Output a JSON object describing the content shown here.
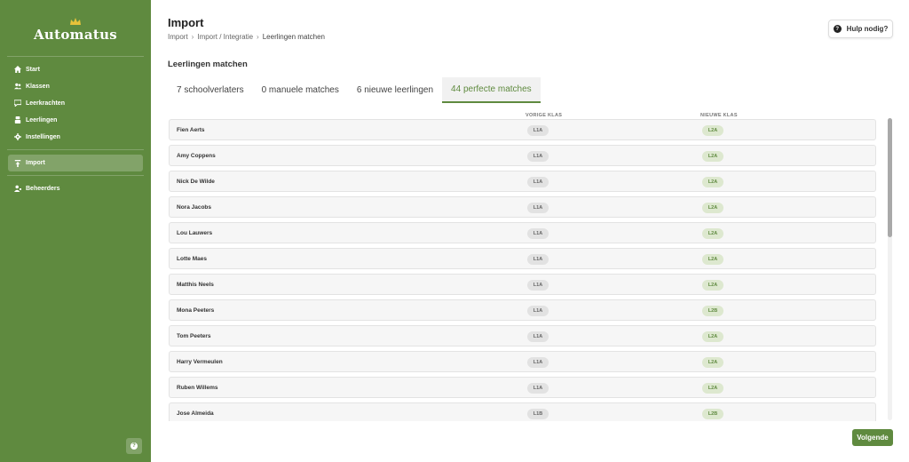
{
  "app": {
    "brand": "Automatus"
  },
  "sidebar": {
    "items": [
      {
        "label": "Start",
        "icon": "home-icon"
      },
      {
        "label": "Klassen",
        "icon": "users-icon"
      },
      {
        "label": "Leerkrachten",
        "icon": "chat-icon"
      },
      {
        "label": "Leerlingen",
        "icon": "student-icon"
      },
      {
        "label": "Instellingen",
        "icon": "gear-icon"
      },
      {
        "label": "Import",
        "icon": "import-icon",
        "active": true
      },
      {
        "label": "Beheerders",
        "icon": "admin-icon"
      }
    ],
    "help_icon": "?"
  },
  "header": {
    "title": "Import",
    "breadcrumb": [
      "Import",
      "Import / Integratie",
      "Leerlingen matchen"
    ],
    "breadcrumb_sep": "›",
    "help_label": "Hulp nodig?",
    "help_icon": "?"
  },
  "section_title": "Leerlingen matchen",
  "tabs": [
    {
      "label": "7 schoolverlaters"
    },
    {
      "label": "0 manuele matches"
    },
    {
      "label": "6 nieuwe leerlingen"
    },
    {
      "label": "44 perfecte matches",
      "active": true
    }
  ],
  "table": {
    "headers": {
      "prev": "VORIGE KLAS",
      "next": "NIEUWE KLAS"
    },
    "rows": [
      {
        "name": "Fien Aerts",
        "prev": "L1A",
        "next": "L2A"
      },
      {
        "name": "Amy Coppens",
        "prev": "L1A",
        "next": "L2A"
      },
      {
        "name": "Nick De Wilde",
        "prev": "L1A",
        "next": "L2A"
      },
      {
        "name": "Nora Jacobs",
        "prev": "L1A",
        "next": "L2A"
      },
      {
        "name": "Lou Lauwers",
        "prev": "L1A",
        "next": "L2A"
      },
      {
        "name": "Lotte Maes",
        "prev": "L1A",
        "next": "L2A"
      },
      {
        "name": "Matthis Neels",
        "prev": "L1A",
        "next": "L2A"
      },
      {
        "name": "Mona Peeters",
        "prev": "L1A",
        "next": "L2B"
      },
      {
        "name": "Tom Peeters",
        "prev": "L1A",
        "next": "L2A"
      },
      {
        "name": "Harry Vermeulen",
        "prev": "L1A",
        "next": "L2A"
      },
      {
        "name": "Ruben Willems",
        "prev": "L1A",
        "next": "L2A"
      },
      {
        "name": "Jose Almeida",
        "prev": "L1B",
        "next": "L2B"
      }
    ]
  },
  "footer": {
    "next_label": "Volgende"
  },
  "colors": {
    "accent": "#5f8a3f",
    "crown": "#e8c23a"
  }
}
